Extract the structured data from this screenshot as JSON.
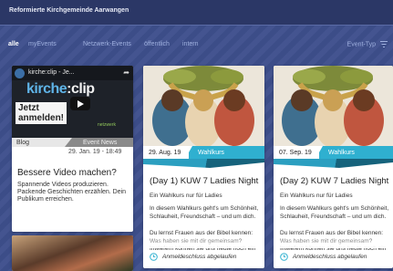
{
  "header": {
    "title": "Reformierte Kirchgemeinde Aarwangen"
  },
  "nav": {
    "tabs": [
      {
        "label": "alle"
      },
      {
        "label": "myEvents"
      },
      {
        "label": "Netzwerk-Events"
      },
      {
        "label": "öffentlich"
      },
      {
        "label": "intern"
      }
    ],
    "filter_label": "Event-Typ"
  },
  "cards": {
    "video": {
      "video_title": "kirche:clip - Je...",
      "logo_main": "kirche",
      "logo_accent": ":clip",
      "slogan_line1": "Jetzt",
      "slogan_line2": "anmelden!",
      "network_text": "netzwerk",
      "category": "Blog",
      "type": "Event News",
      "datetime": "29. Jan. 19 - 18:49",
      "heading": "Bessere Video machen?",
      "body": "Spannende Videos produzieren. Packende Geschichten erzählen. Dein Publikum erreichen."
    },
    "event1": {
      "date": "29. Aug. 19",
      "type": "Wahlkurs",
      "title": "(Day 1) KUW 7 Ladies Night",
      "subtitle": "Ein Wahlkurs nur für Ladies",
      "p1": "In diesem Wahlkurs geht's um Schönheit, Schlauheit, Freundschaft – und um dich.",
      "p2": "Du lernst Frauen aus der Bibel kennen: Was haben sie mit dir gemeinsam? Inwiefern können sie uns heute noch ein",
      "footer": "Anmeldeschluss abgelaufen"
    },
    "event2": {
      "date": "07. Sep. 19",
      "type": "Wahlkurs",
      "title": "(Day 2) KUW 7 Ladies Night",
      "subtitle": "Ein Wahlkurs nur für Ladies",
      "p1": "In diesem Wahlkurs geht's um Schönheit, Schlauheit, Freundschaft – und um dich.",
      "p2": "Du lernst Frauen aus der Bibel kennen: Was haben sie mit dir gemeinsam? Inwiefern können sie uns heute noch ein",
      "footer": "Anmeldeschluss abgelaufen"
    }
  },
  "colors": {
    "accent": "#2fb0d0",
    "background": "#3e4f8c",
    "header": "#2b3766"
  },
  "icons": {
    "filter": "filter-icon",
    "clock": "clock-icon",
    "play": "play-icon",
    "share": "share-icon"
  }
}
